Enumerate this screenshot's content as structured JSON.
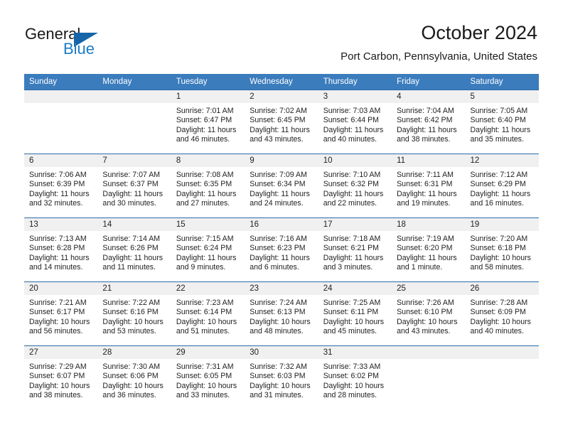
{
  "brand": {
    "name_top": "General",
    "name_bottom": "Blue",
    "accent_color": "#1d7cc4",
    "triangle_color": "#1565a8"
  },
  "header": {
    "title": "October 2024",
    "subtitle": "Port Carbon, Pennsylvania, United States"
  },
  "theme": {
    "header_row_bg": "#3b7cbd",
    "row_divider": "#2c6ca8",
    "daynum_bg": "#f0f0f0",
    "text": "#222222"
  },
  "weekday_headers": [
    "Sunday",
    "Monday",
    "Tuesday",
    "Wednesday",
    "Thursday",
    "Friday",
    "Saturday"
  ],
  "weeks": [
    [
      {
        "day": "",
        "sunrise": "",
        "sunset": "",
        "daylight": ""
      },
      {
        "day": "",
        "sunrise": "",
        "sunset": "",
        "daylight": ""
      },
      {
        "day": "1",
        "sunrise": "Sunrise: 7:01 AM",
        "sunset": "Sunset: 6:47 PM",
        "daylight": "Daylight: 11 hours and 46 minutes."
      },
      {
        "day": "2",
        "sunrise": "Sunrise: 7:02 AM",
        "sunset": "Sunset: 6:45 PM",
        "daylight": "Daylight: 11 hours and 43 minutes."
      },
      {
        "day": "3",
        "sunrise": "Sunrise: 7:03 AM",
        "sunset": "Sunset: 6:44 PM",
        "daylight": "Daylight: 11 hours and 40 minutes."
      },
      {
        "day": "4",
        "sunrise": "Sunrise: 7:04 AM",
        "sunset": "Sunset: 6:42 PM",
        "daylight": "Daylight: 11 hours and 38 minutes."
      },
      {
        "day": "5",
        "sunrise": "Sunrise: 7:05 AM",
        "sunset": "Sunset: 6:40 PM",
        "daylight": "Daylight: 11 hours and 35 minutes."
      }
    ],
    [
      {
        "day": "6",
        "sunrise": "Sunrise: 7:06 AM",
        "sunset": "Sunset: 6:39 PM",
        "daylight": "Daylight: 11 hours and 32 minutes."
      },
      {
        "day": "7",
        "sunrise": "Sunrise: 7:07 AM",
        "sunset": "Sunset: 6:37 PM",
        "daylight": "Daylight: 11 hours and 30 minutes."
      },
      {
        "day": "8",
        "sunrise": "Sunrise: 7:08 AM",
        "sunset": "Sunset: 6:35 PM",
        "daylight": "Daylight: 11 hours and 27 minutes."
      },
      {
        "day": "9",
        "sunrise": "Sunrise: 7:09 AM",
        "sunset": "Sunset: 6:34 PM",
        "daylight": "Daylight: 11 hours and 24 minutes."
      },
      {
        "day": "10",
        "sunrise": "Sunrise: 7:10 AM",
        "sunset": "Sunset: 6:32 PM",
        "daylight": "Daylight: 11 hours and 22 minutes."
      },
      {
        "day": "11",
        "sunrise": "Sunrise: 7:11 AM",
        "sunset": "Sunset: 6:31 PM",
        "daylight": "Daylight: 11 hours and 19 minutes."
      },
      {
        "day": "12",
        "sunrise": "Sunrise: 7:12 AM",
        "sunset": "Sunset: 6:29 PM",
        "daylight": "Daylight: 11 hours and 16 minutes."
      }
    ],
    [
      {
        "day": "13",
        "sunrise": "Sunrise: 7:13 AM",
        "sunset": "Sunset: 6:28 PM",
        "daylight": "Daylight: 11 hours and 14 minutes."
      },
      {
        "day": "14",
        "sunrise": "Sunrise: 7:14 AM",
        "sunset": "Sunset: 6:26 PM",
        "daylight": "Daylight: 11 hours and 11 minutes."
      },
      {
        "day": "15",
        "sunrise": "Sunrise: 7:15 AM",
        "sunset": "Sunset: 6:24 PM",
        "daylight": "Daylight: 11 hours and 9 minutes."
      },
      {
        "day": "16",
        "sunrise": "Sunrise: 7:16 AM",
        "sunset": "Sunset: 6:23 PM",
        "daylight": "Daylight: 11 hours and 6 minutes."
      },
      {
        "day": "17",
        "sunrise": "Sunrise: 7:18 AM",
        "sunset": "Sunset: 6:21 PM",
        "daylight": "Daylight: 11 hours and 3 minutes."
      },
      {
        "day": "18",
        "sunrise": "Sunrise: 7:19 AM",
        "sunset": "Sunset: 6:20 PM",
        "daylight": "Daylight: 11 hours and 1 minute."
      },
      {
        "day": "19",
        "sunrise": "Sunrise: 7:20 AM",
        "sunset": "Sunset: 6:18 PM",
        "daylight": "Daylight: 10 hours and 58 minutes."
      }
    ],
    [
      {
        "day": "20",
        "sunrise": "Sunrise: 7:21 AM",
        "sunset": "Sunset: 6:17 PM",
        "daylight": "Daylight: 10 hours and 56 minutes."
      },
      {
        "day": "21",
        "sunrise": "Sunrise: 7:22 AM",
        "sunset": "Sunset: 6:16 PM",
        "daylight": "Daylight: 10 hours and 53 minutes."
      },
      {
        "day": "22",
        "sunrise": "Sunrise: 7:23 AM",
        "sunset": "Sunset: 6:14 PM",
        "daylight": "Daylight: 10 hours and 51 minutes."
      },
      {
        "day": "23",
        "sunrise": "Sunrise: 7:24 AM",
        "sunset": "Sunset: 6:13 PM",
        "daylight": "Daylight: 10 hours and 48 minutes."
      },
      {
        "day": "24",
        "sunrise": "Sunrise: 7:25 AM",
        "sunset": "Sunset: 6:11 PM",
        "daylight": "Daylight: 10 hours and 45 minutes."
      },
      {
        "day": "25",
        "sunrise": "Sunrise: 7:26 AM",
        "sunset": "Sunset: 6:10 PM",
        "daylight": "Daylight: 10 hours and 43 minutes."
      },
      {
        "day": "26",
        "sunrise": "Sunrise: 7:28 AM",
        "sunset": "Sunset: 6:09 PM",
        "daylight": "Daylight: 10 hours and 40 minutes."
      }
    ],
    [
      {
        "day": "27",
        "sunrise": "Sunrise: 7:29 AM",
        "sunset": "Sunset: 6:07 PM",
        "daylight": "Daylight: 10 hours and 38 minutes."
      },
      {
        "day": "28",
        "sunrise": "Sunrise: 7:30 AM",
        "sunset": "Sunset: 6:06 PM",
        "daylight": "Daylight: 10 hours and 36 minutes."
      },
      {
        "day": "29",
        "sunrise": "Sunrise: 7:31 AM",
        "sunset": "Sunset: 6:05 PM",
        "daylight": "Daylight: 10 hours and 33 minutes."
      },
      {
        "day": "30",
        "sunrise": "Sunrise: 7:32 AM",
        "sunset": "Sunset: 6:03 PM",
        "daylight": "Daylight: 10 hours and 31 minutes."
      },
      {
        "day": "31",
        "sunrise": "Sunrise: 7:33 AM",
        "sunset": "Sunset: 6:02 PM",
        "daylight": "Daylight: 10 hours and 28 minutes."
      },
      {
        "day": "",
        "sunrise": "",
        "sunset": "",
        "daylight": ""
      },
      {
        "day": "",
        "sunrise": "",
        "sunset": "",
        "daylight": ""
      }
    ]
  ]
}
